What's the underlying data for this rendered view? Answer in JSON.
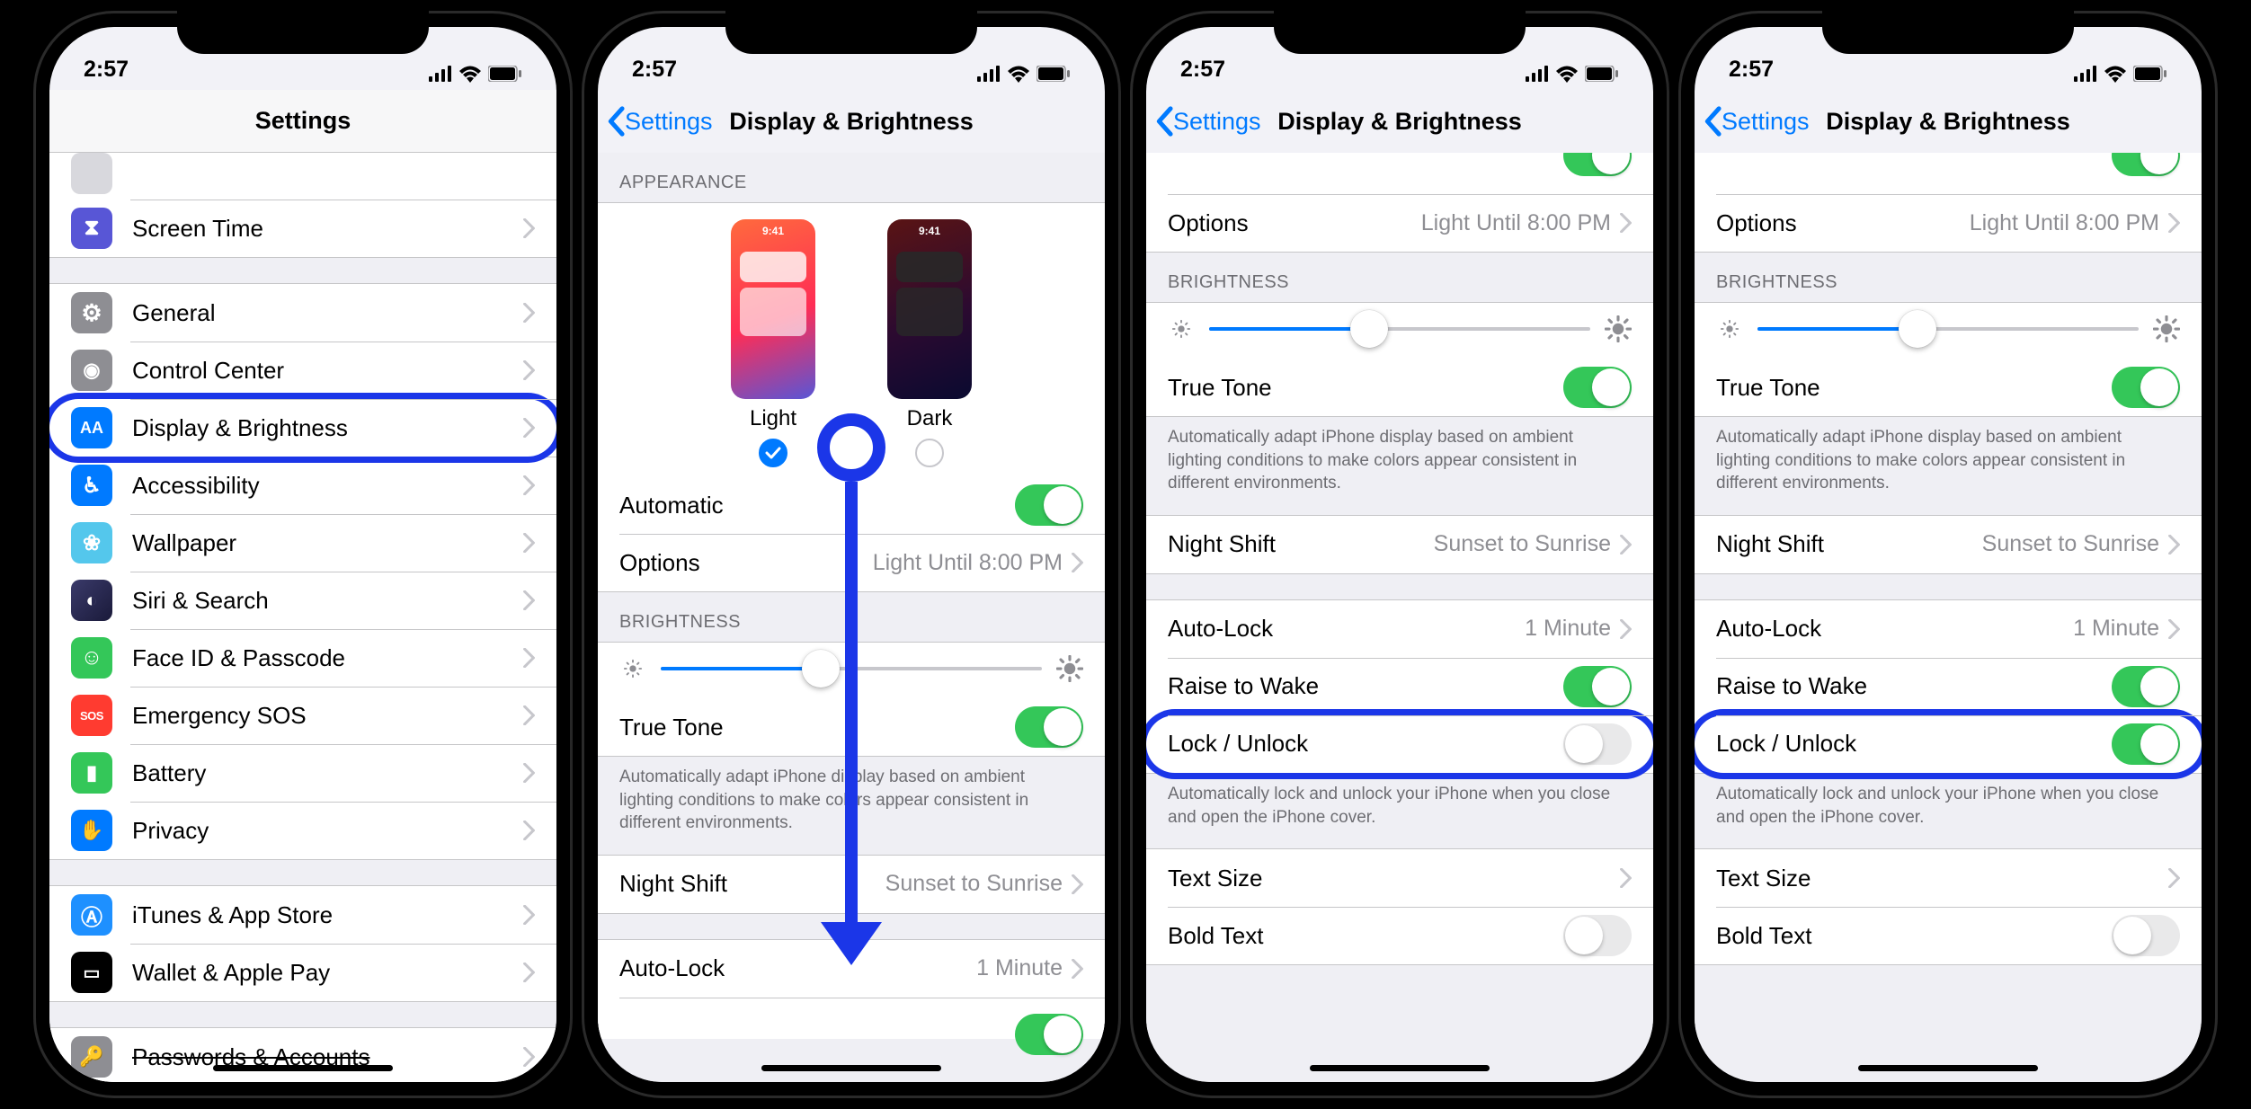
{
  "status": {
    "time": "2:57"
  },
  "phone1": {
    "title": "Settings",
    "items": [
      {
        "label": "Screen Time",
        "icon_bg": "#5856d6",
        "glyph": "⧗",
        "name": "screen-time"
      },
      {
        "label": "General",
        "icon_bg": "#8e8e93",
        "glyph": "⚙",
        "name": "general"
      },
      {
        "label": "Control Center",
        "icon_bg": "#8e8e93",
        "glyph": "◉",
        "name": "control-center"
      },
      {
        "label": "Display & Brightness",
        "icon_bg": "#007aff",
        "glyph": "AA",
        "name": "display-brightness",
        "highlight": true
      },
      {
        "label": "Accessibility",
        "icon_bg": "#007aff",
        "glyph": "♿︎",
        "name": "accessibility"
      },
      {
        "label": "Wallpaper",
        "icon_bg": "#54c7ec",
        "glyph": "❀",
        "name": "wallpaper"
      },
      {
        "label": "Siri & Search",
        "icon_bg": "#1f1f3d",
        "glyph": "◐",
        "name": "siri-search"
      },
      {
        "label": "Face ID & Passcode",
        "icon_bg": "#34c759",
        "glyph": "☺",
        "name": "faceid-passcode"
      },
      {
        "label": "Emergency SOS",
        "icon_bg": "#ff3b30",
        "glyph": "SOS",
        "name": "emergency-sos",
        "small": true
      },
      {
        "label": "Battery",
        "icon_bg": "#34c759",
        "glyph": "▮",
        "name": "battery"
      },
      {
        "label": "Privacy",
        "icon_bg": "#007aff",
        "glyph": "✋",
        "name": "privacy"
      },
      {
        "label": "iTunes & App Store",
        "icon_bg": "#1e90ff",
        "glyph": "A",
        "name": "itunes-appstore"
      },
      {
        "label": "Wallet & Apple Pay",
        "icon_bg": "#000",
        "glyph": "▭",
        "name": "wallet-applepay"
      },
      {
        "label": "Passwords & Accounts",
        "icon_bg": "#8e8e93",
        "glyph": "🔑",
        "name": "passwords-accounts"
      }
    ]
  },
  "db": {
    "back": "Settings",
    "title": "Display & Brightness",
    "appearance_header": "APPEARANCE",
    "light": "Light",
    "dark": "Dark",
    "thumb_time": "9:41",
    "automatic": "Automatic",
    "options": "Options",
    "options_detail": "Light Until 8:00 PM",
    "brightness_header": "BRIGHTNESS",
    "truetone": "True Tone",
    "truetone_footer": "Automatically adapt iPhone display based on ambient lighting conditions to make colors appear consistent in different environments.",
    "nightshift": "Night Shift",
    "nightshift_detail": "Sunset to Sunrise",
    "autolock": "Auto-Lock",
    "autolock_detail": "1 Minute",
    "raise": "Raise to Wake",
    "lockunlock": "Lock / Unlock",
    "lockunlock_footer": "Automatically lock and unlock your iPhone when you close and open the iPhone cover.",
    "textsize": "Text Size",
    "boldtext": "Bold Text",
    "slider_pct": 42
  },
  "phone3": {
    "lockunlock_on": false
  },
  "phone4": {
    "lockunlock_on": true
  }
}
